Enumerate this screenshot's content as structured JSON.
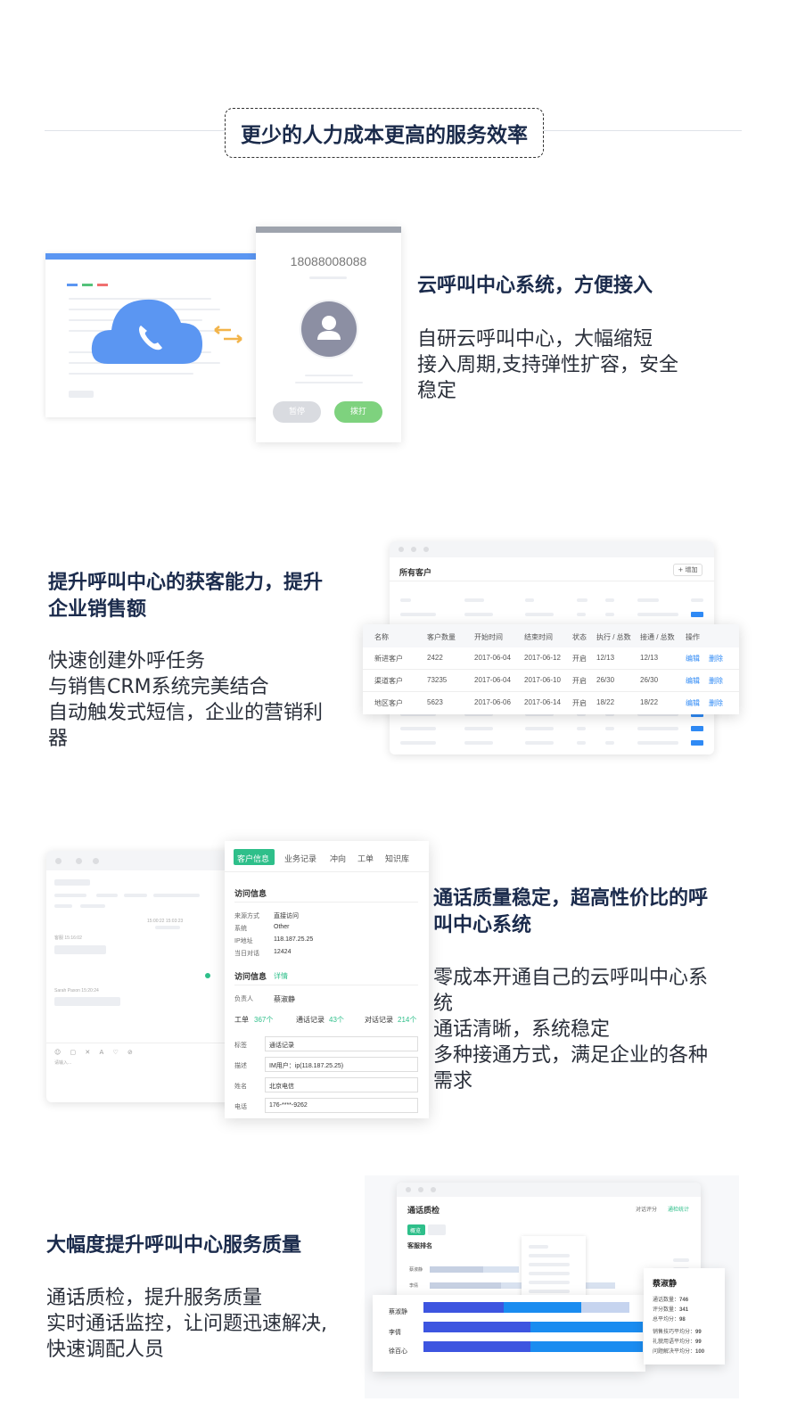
{
  "header": {
    "title": "更少的人力成本更高的服务效率"
  },
  "feature1": {
    "title": "云呼叫中心系统，方便接入",
    "desc": [
      "自研云呼叫中心，大幅缩短",
      "接入周期,支持弹性扩容，安全",
      "稳定"
    ],
    "phone_number": "18088008088",
    "pause_label": "暂停",
    "dial_label": "拨打"
  },
  "feature2": {
    "title_lines": [
      "提升呼叫中心的获客能力，提升",
      "企业销售额"
    ],
    "desc": [
      "快速创建外呼任务",
      "与销售CRM系统完美结合",
      "自动触发式短信，企业的营销利",
      "器"
    ],
    "panel_title": "所有客户",
    "add_label": "+ 增加",
    "table": {
      "headers": [
        "名称",
        "客户数量",
        "开始时间",
        "结束时间",
        "状态",
        "执行 / 总数",
        "接通 / 总数",
        "操作"
      ],
      "rows": [
        [
          "新进客户",
          "2422",
          "2017-06-04",
          "2017-06-12",
          "开启",
          "12/13",
          "12/13"
        ],
        [
          "渠道客户",
          "73235",
          "2017-06-04",
          "2017-06-10",
          "开启",
          "26/30",
          "26/30"
        ],
        [
          "地区客户",
          "5623",
          "2017-06-06",
          "2017-06-14",
          "开启",
          "18/22",
          "18/22"
        ]
      ],
      "edit_label": "编辑",
      "delete_label": "删除"
    }
  },
  "feature3": {
    "title_lines": [
      "通话质量稳定，超高性价比的呼",
      "叫中心系统"
    ],
    "desc": [
      "零成本开通自己的云呼叫中心系",
      "统",
      "通话清晰，系统稳定",
      "多种接通方式，满足企业的各种",
      "需求"
    ],
    "tabs": [
      "客户信息",
      "业务记录",
      "冲向",
      "工单",
      "知识库"
    ],
    "section1_title": "访问信息",
    "info_rows": [
      {
        "label": "来源方式",
        "value": "直接访问"
      },
      {
        "label": "系统",
        "value": "Other"
      },
      {
        "label": "IP地址",
        "value": "118.187.25.25"
      },
      {
        "label": "当日对话",
        "value": "12424"
      }
    ],
    "section2_title": "访问信息",
    "section2_link": "详情",
    "owner_label": "负责人",
    "owner_value": "蔡淑静",
    "stats": [
      {
        "label": "工单",
        "value": "367个"
      },
      {
        "label": "通话记录",
        "value": "43个"
      },
      {
        "label": "对话记录",
        "value": "214个"
      }
    ],
    "fields": [
      {
        "label": "标签",
        "value": "通话记录"
      },
      {
        "label": "描述",
        "value": "IM用户：ip(118.187.25.25)"
      },
      {
        "label": "姓名",
        "value": "北京电信"
      },
      {
        "label": "电话",
        "value": "176-****-9262"
      }
    ],
    "chat_time_1": "15:00:22 15:03:23",
    "chat_name_1": "客服 15:16:02",
    "chat_name_2": "Sarah Paxon 15:20:24",
    "chat_input_hint": "请输入..."
  },
  "feature4": {
    "title": "大幅度提升呼叫中心服务质量",
    "desc": [
      "通话质检，提升服务质量",
      "实时通话监控，让问题迅速解决,",
      "快速调配人员"
    ],
    "panel_title": "通话质检",
    "top_links": [
      "对话评分",
      "通检统计"
    ],
    "tab_active": "概览",
    "section_title": "客服排名",
    "mini_rows": [
      "蔡淑静",
      "李倩"
    ],
    "bars": [
      {
        "name": "蔡淑静",
        "v1": 0.3,
        "v2": 0.29,
        "v3": 0.18
      },
      {
        "name": "李倩",
        "v1": 0.4,
        "v2": 0.42,
        "v3": 0.0
      },
      {
        "name": "徐百心",
        "v1": 0.4,
        "v2": 0.42,
        "v3": 0.0
      }
    ],
    "popup": {
      "name": "蔡淑静",
      "rows": [
        {
          "label": "通话数量：",
          "value": "746"
        },
        {
          "label": "评分数量：",
          "value": "341"
        },
        {
          "label": "总平均分：",
          "value": "98"
        },
        {
          "label": "销售技巧平均分：",
          "value": "99"
        },
        {
          "label": "礼貌用语平均分：",
          "value": "99"
        },
        {
          "label": "问题解决平均分：",
          "value": "100"
        }
      ]
    },
    "colors": {
      "bar1": "#3d55e0",
      "bar2": "#1a8cf0",
      "bar3": "#c6d4ef"
    }
  }
}
